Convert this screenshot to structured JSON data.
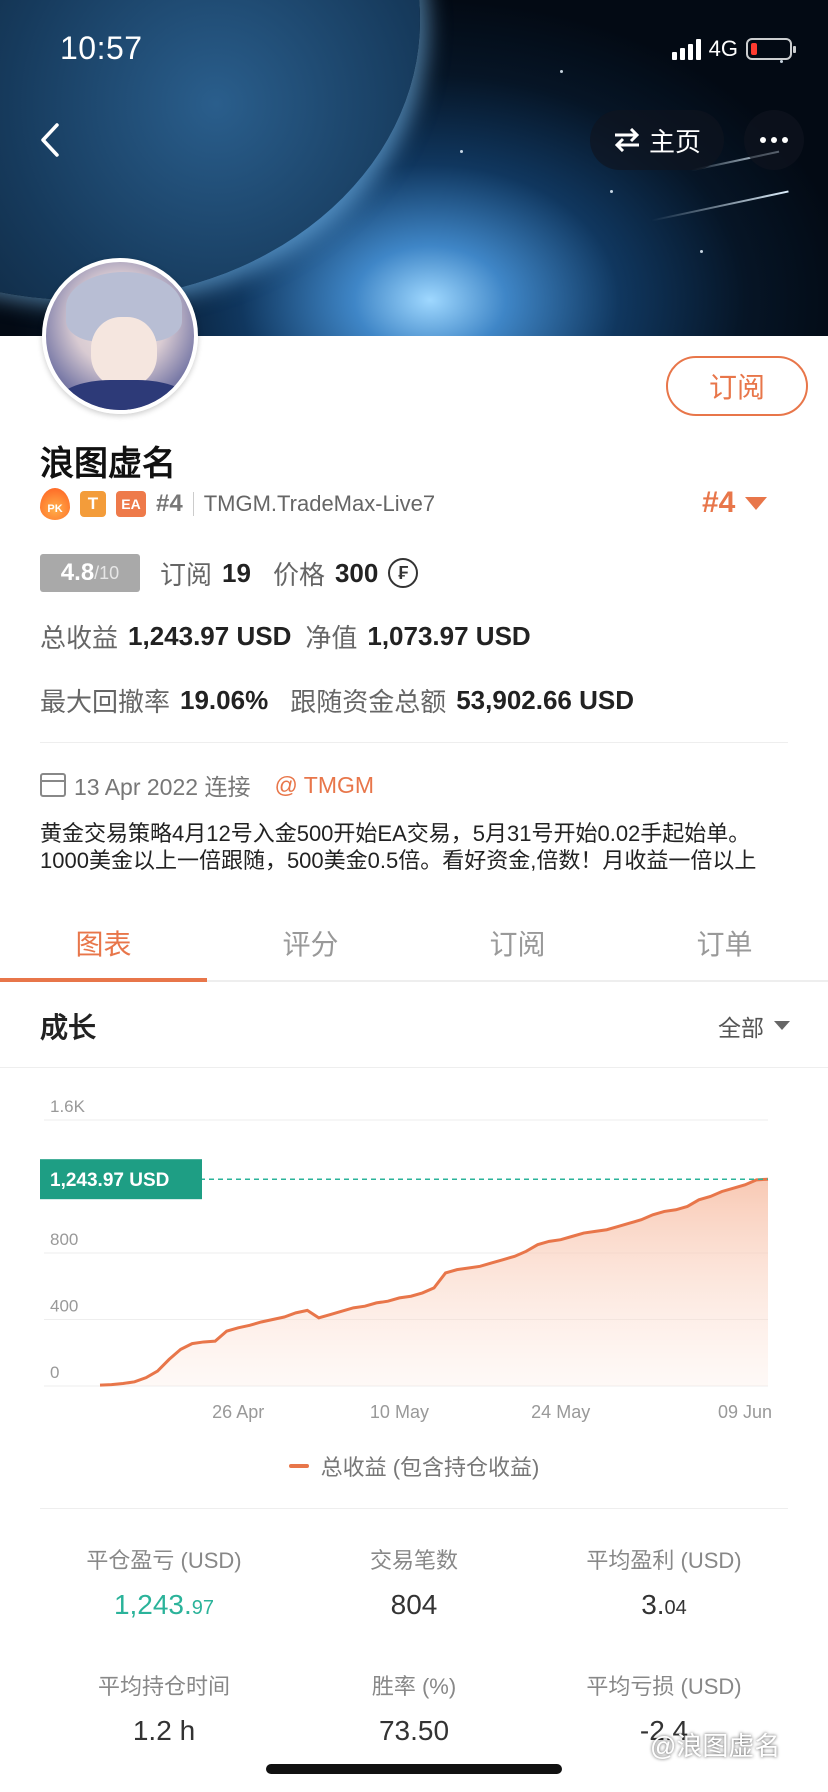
{
  "status_bar": {
    "time": "10:57",
    "network": "4G"
  },
  "header": {
    "home_label": "主页"
  },
  "profile": {
    "name": "浪图虚名",
    "badges": {
      "pk": "PK",
      "t": "T",
      "ea": "EA"
    },
    "rank": "#4",
    "server": "TMGM.TradeMax-Live7",
    "subscribe_label": "订阅",
    "score": "4.8",
    "score_max": "/10",
    "subscribe_count_label": "订阅",
    "subscribe_count": "19",
    "price_label": "价格",
    "price": "300",
    "price_currency_icon": "₣",
    "total_profit_label": "总收益",
    "total_profit": "1,243.97 USD",
    "net_value_label": "净值",
    "net_value": "1,073.97 USD",
    "max_drawdown_label": "最大回撤率",
    "max_drawdown": "19.06%",
    "follow_funds_label": "跟随资金总额",
    "follow_funds": "53,902.66 USD",
    "connected_date": "13 Apr 2022 连接",
    "broker": "@ TMGM",
    "description": "黄金交易策略4月12号入金500开始EA交易，5月31号开始0.02手起始单。1000美金以上一倍跟随，500美金0.5倍。看好资金,倍数！月收益一倍以上"
  },
  "tabs": [
    {
      "label": "图表",
      "active": true
    },
    {
      "label": "评分",
      "active": false
    },
    {
      "label": "订阅",
      "active": false
    },
    {
      "label": "订单",
      "active": false
    }
  ],
  "section": {
    "title": "成长",
    "filter": "全部"
  },
  "chart_data": {
    "type": "area",
    "y_ticks": [
      "0",
      "400",
      "800",
      "1.6K"
    ],
    "x_ticks": [
      "26 Apr",
      "10 May",
      "24 May",
      "09 Jun"
    ],
    "ylim": [
      0,
      1600
    ],
    "current_label": "1,243.97 USD",
    "current_value": 1243.97,
    "series": [
      {
        "name": "总收益 (包含持仓收益)",
        "color": "#e8764a",
        "x": [
          "14 Apr",
          "15 Apr",
          "16 Apr",
          "17 Apr",
          "18 Apr",
          "19 Apr",
          "20 Apr",
          "21 Apr",
          "22 Apr",
          "23 Apr",
          "24 Apr",
          "25 Apr",
          "26 Apr",
          "27 Apr",
          "28 Apr",
          "29 Apr",
          "30 Apr",
          "01 May",
          "02 May",
          "03 May",
          "04 May",
          "05 May",
          "06 May",
          "07 May",
          "08 May",
          "09 May",
          "10 May",
          "11 May",
          "12 May",
          "13 May",
          "14 May",
          "15 May",
          "16 May",
          "17 May",
          "18 May",
          "19 May",
          "20 May",
          "21 May",
          "22 May",
          "23 May",
          "24 May",
          "25 May",
          "26 May",
          "27 May",
          "28 May",
          "29 May",
          "30 May",
          "31 May",
          "01 Jun",
          "02 Jun",
          "03 Jun",
          "04 Jun",
          "05 Jun",
          "06 Jun",
          "07 Jun",
          "08 Jun",
          "09 Jun",
          "10 Jun",
          "11 Jun"
        ],
        "values": [
          5,
          8,
          15,
          25,
          50,
          90,
          160,
          220,
          255,
          265,
          270,
          330,
          350,
          365,
          385,
          400,
          415,
          440,
          455,
          410,
          430,
          450,
          470,
          480,
          500,
          510,
          530,
          540,
          560,
          590,
          680,
          700,
          710,
          720,
          740,
          760,
          780,
          810,
          850,
          870,
          880,
          900,
          920,
          930,
          940,
          960,
          980,
          1000,
          1030,
          1050,
          1060,
          1080,
          1120,
          1140,
          1170,
          1190,
          1210,
          1240,
          1243.97
        ]
      }
    ]
  },
  "legend": "总收益 (包含持仓收益)",
  "metrics": [
    {
      "label": "平仓盈亏 (USD)",
      "main": "1,243.",
      "small": "97",
      "green": true
    },
    {
      "label": "交易笔数",
      "main": "804",
      "small": "",
      "green": false
    },
    {
      "label": "平均盈利 (USD)",
      "main": "3.",
      "small": "04",
      "green": false
    },
    {
      "label": "平均持仓时间",
      "main": "1.2 h",
      "small": "",
      "green": false
    },
    {
      "label": "胜率 (%)",
      "main": "73.50",
      "small": "",
      "green": false
    },
    {
      "label": "平均亏损 (USD)",
      "main": "-2.4",
      "small": "",
      "green": false
    }
  ],
  "watermark": "@浪图虚名"
}
